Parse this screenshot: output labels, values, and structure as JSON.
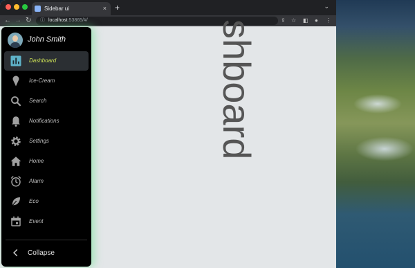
{
  "browser": {
    "tab_title": "Sidebar ui",
    "tab_close": "×",
    "new_tab": "+",
    "tab_menu": "⌄",
    "url_host": "localhost",
    "url_rest": ":53865/#/"
  },
  "page": {
    "title_visible": "shboard"
  },
  "sidebar": {
    "user_name": "John Smith",
    "items": [
      {
        "label": "Dashboard",
        "icon": "chart-icon",
        "active": true
      },
      {
        "label": "Ice-Cream",
        "icon": "ice-cream-icon"
      },
      {
        "label": "Search",
        "icon": "search-icon"
      },
      {
        "label": "Notifications",
        "icon": "bell-icon"
      },
      {
        "label": "Settings",
        "icon": "gear-icon"
      },
      {
        "label": "Home",
        "icon": "home-icon"
      },
      {
        "label": "Alarm",
        "icon": "alarm-icon"
      },
      {
        "label": "Eco",
        "icon": "leaf-icon"
      },
      {
        "label": "Event",
        "icon": "calendar-icon"
      }
    ],
    "collapse_label": "Collapse"
  },
  "colors": {
    "active_label": "#cfe356",
    "active_icon": "#5fb3c9",
    "sidebar_glow": "#64e68c"
  }
}
